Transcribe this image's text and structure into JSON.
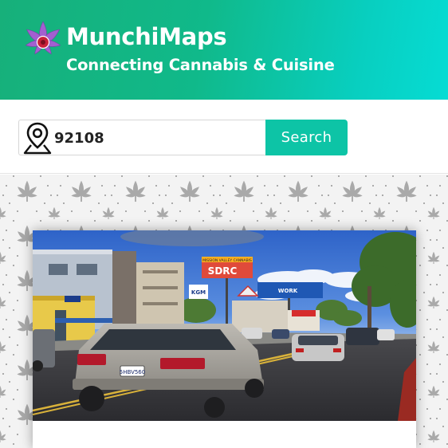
{
  "app": {
    "name": "MunchiMaps",
    "tagline": "Connecting Cannabis & Cuisine"
  },
  "search": {
    "value": "92108",
    "button_label": "Search",
    "icon": "map-pin-icon"
  },
  "billboards": {
    "top_banner": "MISSION VALLEY CANNABIS",
    "main": "SDRC",
    "side": "WORK",
    "store_sign": "KGM"
  },
  "car_plate": "5HBV560",
  "colors": {
    "header_start": "#17b07a",
    "header_end": "#06dcd4",
    "search_button": "#0dc4a6",
    "brand_text": "#ffffff",
    "logo_leaf": "#a35fd0",
    "logo_center": "#c8203a"
  }
}
